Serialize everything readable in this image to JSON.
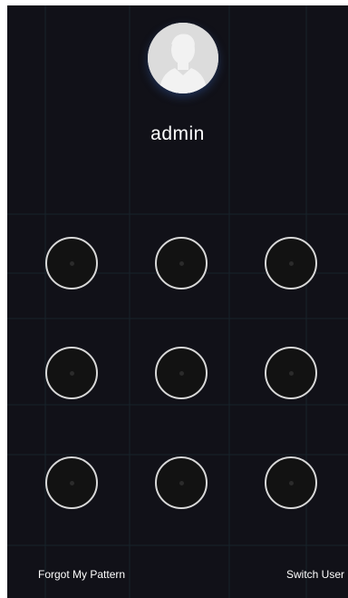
{
  "user": {
    "name": "admin",
    "avatar_icon": "user-avatar-icon"
  },
  "pattern": {
    "dots": [
      1,
      2,
      3,
      4,
      5,
      6,
      7,
      8,
      9
    ],
    "dot_border_color": "#d8d8d8"
  },
  "footer": {
    "forgot_label": "Forgot My Pattern",
    "switch_label": "Switch User"
  },
  "colors": {
    "background": "#111118",
    "text": "#ffffff"
  }
}
